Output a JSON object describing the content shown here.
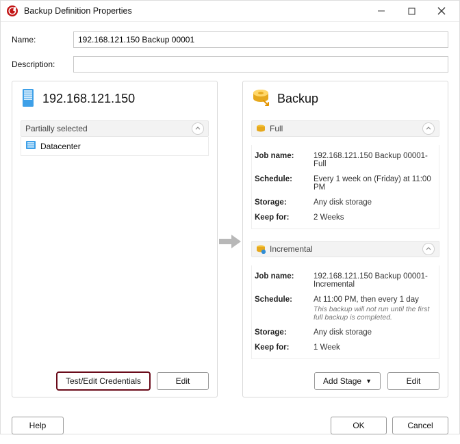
{
  "window": {
    "title": "Backup Definition Properties"
  },
  "form": {
    "name_label": "Name:",
    "name_value": "192.168.121.150 Backup 00001",
    "desc_label": "Description:",
    "desc_value": ""
  },
  "source": {
    "title": "192.168.121.150",
    "section_label": "Partially selected",
    "item_label": "Datacenter",
    "test_credentials_btn": "Test/Edit Credentials",
    "edit_btn": "Edit"
  },
  "backup": {
    "title": "Backup",
    "labels": {
      "job_name": "Job name:",
      "schedule": "Schedule:",
      "storage": "Storage:",
      "keep_for": "Keep for:"
    },
    "full": {
      "header": "Full",
      "job_name": "192.168.121.150 Backup 00001-Full",
      "schedule": "Every 1 week on (Friday) at 11:00 PM",
      "storage": "Any disk storage",
      "keep_for": "2 Weeks"
    },
    "incremental": {
      "header": "Incremental",
      "job_name": "192.168.121.150 Backup 00001-Incremental",
      "schedule": "At 11:00 PM, then every 1 day",
      "schedule_note": "This backup will not run until the first full backup is completed.",
      "storage": "Any disk storage",
      "keep_for": "1 Week"
    },
    "add_stage_btn": "Add Stage",
    "edit_btn": "Edit"
  },
  "footer": {
    "help": "Help",
    "ok": "OK",
    "cancel": "Cancel"
  }
}
